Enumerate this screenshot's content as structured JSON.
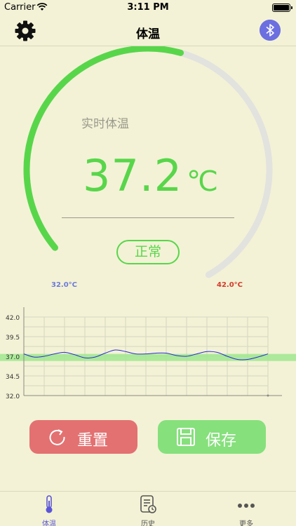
{
  "status_bar": {
    "carrier": "Carrier",
    "time": "3:11 PM"
  },
  "nav": {
    "title": "体温"
  },
  "gauge": {
    "label": "实时体温",
    "value": "37.2",
    "unit": "℃",
    "status": "正常",
    "min_label": "32.0°C",
    "max_label": "42.0°C",
    "min": 32.0,
    "max": 42.0,
    "current": 37.2,
    "progress_color": "#58d64a",
    "track_color": "#e2e2df"
  },
  "chart_data": {
    "type": "line",
    "y_ticks": [
      "42.0",
      "39.5",
      "37.0",
      "34.5",
      "32.0"
    ],
    "ylim": [
      32.0,
      42.0
    ],
    "x": [
      0,
      1,
      2,
      3,
      4,
      5,
      6,
      7,
      8,
      9,
      10,
      11,
      12,
      13,
      14,
      15,
      16,
      17,
      18,
      19,
      20,
      21,
      22,
      23,
      24
    ],
    "values": [
      37.3,
      36.9,
      37.0,
      37.3,
      37.5,
      37.2,
      36.8,
      36.9,
      37.4,
      37.8,
      37.6,
      37.3,
      37.3,
      37.4,
      37.4,
      37.1,
      37.0,
      37.3,
      37.6,
      37.5,
      37.0,
      36.6,
      36.6,
      36.9,
      37.3
    ],
    "normal_band": [
      36.4,
      37.3
    ],
    "grid": true,
    "line_color": "#2b2bd6",
    "band_color": "#9fe88f"
  },
  "buttons": {
    "reset": "重置",
    "save": "保存"
  },
  "tabs": [
    {
      "label": "体温"
    },
    {
      "label": "历史"
    },
    {
      "label": "更多"
    }
  ]
}
